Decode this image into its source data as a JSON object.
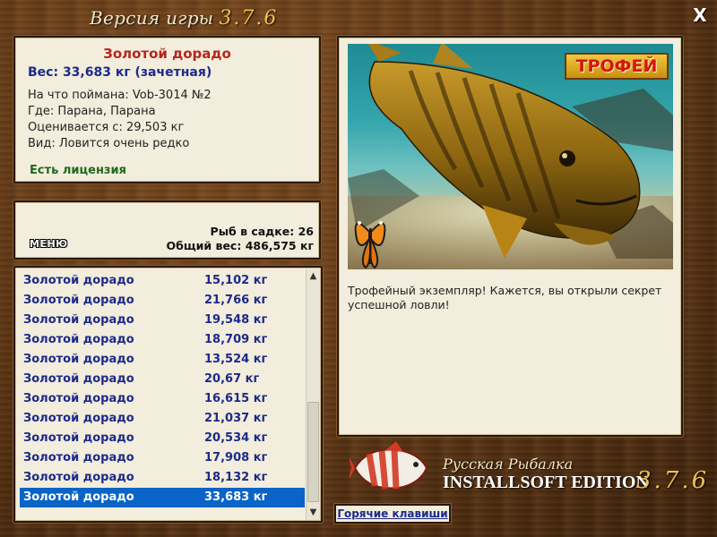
{
  "window": {
    "title_prefix": "Версия игры",
    "title_version": "3.7.6",
    "close_label": "X"
  },
  "fish_info": {
    "name": "Золотой дорадо",
    "weight": "Вес: 33,683 кг (зачетная)",
    "bait": "На что поймана: Vob-3014 №2",
    "location": "Где: Парана, Парана",
    "valued_from": "Оценивается с: 29,503 кг",
    "rarity": "Вид: Ловится очень редко",
    "license": "Есть лицензия"
  },
  "keepnet": {
    "count": "Рыб в садке: 26",
    "total_weight": "Общий вес: 486,575 кг",
    "menu_label": "МЕНЮ"
  },
  "catch_list": [
    {
      "name": "Золотой дорадо",
      "weight": "15,102 кг"
    },
    {
      "name": "Золотой дорадо",
      "weight": "21,766 кг"
    },
    {
      "name": "Золотой дорадо",
      "weight": "19,548 кг"
    },
    {
      "name": "Золотой дорадо",
      "weight": "18,709 кг"
    },
    {
      "name": "Золотой дорадо",
      "weight": "13,524 кг"
    },
    {
      "name": "Золотой дорадо",
      "weight": "20,67 кг"
    },
    {
      "name": "Золотой дорадо",
      "weight": "16,615 кг"
    },
    {
      "name": "Золотой дорадо",
      "weight": "21,037 кг"
    },
    {
      "name": "Золотой дорадо",
      "weight": "20,534 кг"
    },
    {
      "name": "Золотой дорадо",
      "weight": "17,908 кг"
    },
    {
      "name": "Золотой дорадо",
      "weight": "18,132 кг"
    },
    {
      "name": "Золотой дорадо",
      "weight": "33,683 кг"
    }
  ],
  "selected_index": 11,
  "photo": {
    "badge": "ТРОФЕЙ",
    "description": "Трофейный экземпляр! Кажется, вы открыли секрет успешной ловли!"
  },
  "branding": {
    "line1": "Русская Рыбалка",
    "line2": "INSTALLSOFT EDITION",
    "version": "3.7.6"
  },
  "hotkeys_label": "Горячие клавиши",
  "icons": {
    "close": "close-icon",
    "scroll_up": "chevron-up-icon",
    "scroll_down": "chevron-down-icon",
    "butterfly": "butterfly-icon",
    "logo_fish": "fish-logo-icon"
  },
  "colors": {
    "accent_blue": "#1c2a8a",
    "title_red": "#b3261e",
    "license_green": "#1e6a1e",
    "selection": "#0a64c8",
    "version_gold": "#f0c24c"
  }
}
